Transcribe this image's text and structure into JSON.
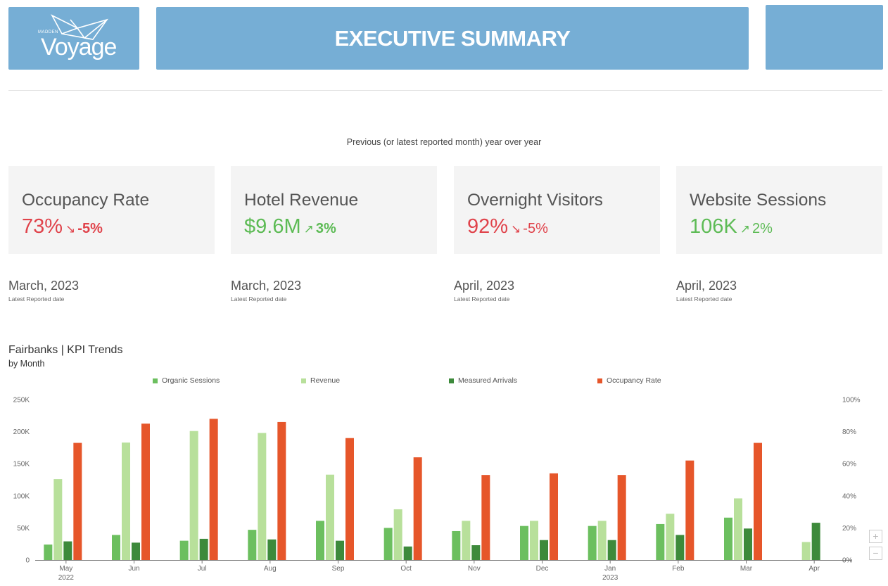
{
  "header": {
    "logo_small": "MADDEN",
    "logo_text": "Voyage",
    "title": "EXECUTIVE SUMMARY"
  },
  "subtitle": "Previous (or latest reported month) year over year",
  "kpis": [
    {
      "label": "Occupancy Rate",
      "value": "73%",
      "arrow": "↘",
      "change": "-5%",
      "trend": "down"
    },
    {
      "label": "Hotel Revenue",
      "value": "$9.6M",
      "arrow": "↗",
      "change": "3%",
      "trend": "up"
    },
    {
      "label": "Overnight Visitors",
      "value": "92%",
      "arrow": "↘",
      "change": "-5%",
      "trend": "down"
    },
    {
      "label": "Website Sessions",
      "value": "106K",
      "arrow": "↗",
      "change": "2%",
      "trend": "up"
    }
  ],
  "dates": [
    {
      "date": "March, 2023",
      "note": "Latest Reported date"
    },
    {
      "date": "March, 2023",
      "note": "Latest Reported date"
    },
    {
      "date": "April, 2023",
      "note": "Latest Reported date"
    },
    {
      "date": "April, 2023",
      "note": "Latest Reported date"
    }
  ],
  "colors": {
    "header_blue": "#76aed5",
    "negative": "#e0434b",
    "positive": "#5dbb55"
  },
  "zoom": {
    "plus": "+",
    "minus": "−"
  },
  "chart_data": {
    "type": "bar",
    "title": "Fairbanks | KPI Trends",
    "subtitle": "by Month",
    "categories": [
      "May",
      "Jun",
      "Jul",
      "Aug",
      "Sep",
      "Oct",
      "Nov",
      "Dec",
      "Jan",
      "Feb",
      "Mar",
      "Apr"
    ],
    "category_years": [
      "2022",
      "",
      "",
      "",
      "",
      "",
      "",
      "",
      "2023",
      "",
      "",
      ""
    ],
    "series": [
      {
        "name": "Organic Sessions",
        "axis": "left",
        "color": "#6cbf5f",
        "values": [
          24000,
          39000,
          30000,
          47000,
          61000,
          50000,
          45000,
          53000,
          53000,
          56000,
          66000,
          null
        ]
      },
      {
        "name": "Revenue",
        "axis": "left",
        "color": "#b8e09b",
        "values": [
          126000,
          183000,
          201000,
          198000,
          133000,
          79000,
          61000,
          61000,
          61000,
          72000,
          96000,
          28000
        ]
      },
      {
        "name": "Measured Arrivals",
        "axis": "left",
        "color": "#3d8a3b",
        "values": [
          29000,
          27000,
          33000,
          32000,
          30000,
          21000,
          23000,
          31000,
          31000,
          39000,
          49000,
          58000
        ]
      },
      {
        "name": "Occupancy Rate",
        "axis": "right",
        "color": "#e6562a",
        "values": [
          73,
          85,
          88,
          86,
          76,
          64,
          53,
          54,
          53,
          62,
          73,
          null
        ]
      }
    ],
    "ylim_left": [
      0,
      250000
    ],
    "yticks_left": [
      "0",
      "50K",
      "100K",
      "150K",
      "200K",
      "250K"
    ],
    "ylim_right": [
      0,
      100
    ],
    "yticks_right": [
      "0%",
      "20%",
      "40%",
      "60%",
      "80%",
      "100%"
    ],
    "legend": "top",
    "grid": false
  }
}
